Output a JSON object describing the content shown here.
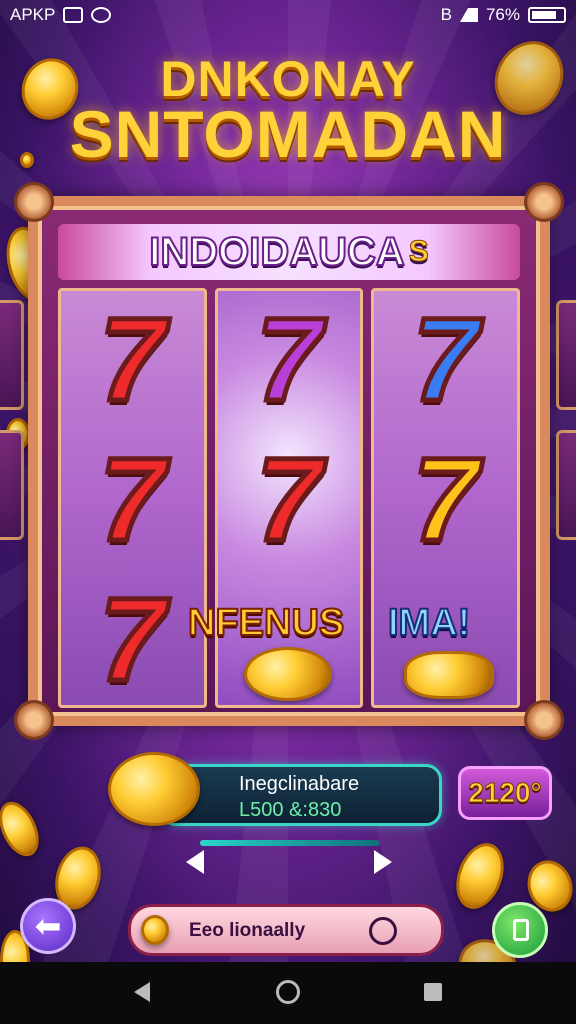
{
  "status_bar": {
    "left_text": "APKP",
    "battery": "76%",
    "bluetooth": "B"
  },
  "title": {
    "line1": "DNKONAY",
    "line2": "SNTOMADAN"
  },
  "banner": {
    "text": "INDOIDAUCA",
    "suffix": "S"
  },
  "reels": [
    {
      "symbols": [
        "7",
        "7",
        "7"
      ],
      "colors": [
        "red",
        "red",
        "red"
      ]
    },
    {
      "symbols": [
        "7",
        "7"
      ],
      "colors": [
        "purple",
        "red"
      ]
    },
    {
      "symbols": [
        "7",
        "7"
      ],
      "colors": [
        "blue",
        "gold"
      ]
    }
  ],
  "bonus": {
    "text": "NFENUS",
    "text2": "IMA!"
  },
  "info_panel": {
    "label": "Inegclinabare",
    "value": "L500 &:830"
  },
  "bet_button": {
    "value": "2120°"
  },
  "bottom_bar": {
    "label": "Eeo lionaally"
  },
  "icons": {
    "back": "back-arrow-icon",
    "wallet": "phone-icon",
    "nav_back": "triangle-back-icon",
    "nav_home": "circle-home-icon",
    "nav_recent": "square-recent-icon"
  },
  "colors": {
    "title": "#ffd23a",
    "panel_border": "#3cd6c8",
    "bet_button": "#d25ad8",
    "green_button": "#1a9a3a"
  }
}
